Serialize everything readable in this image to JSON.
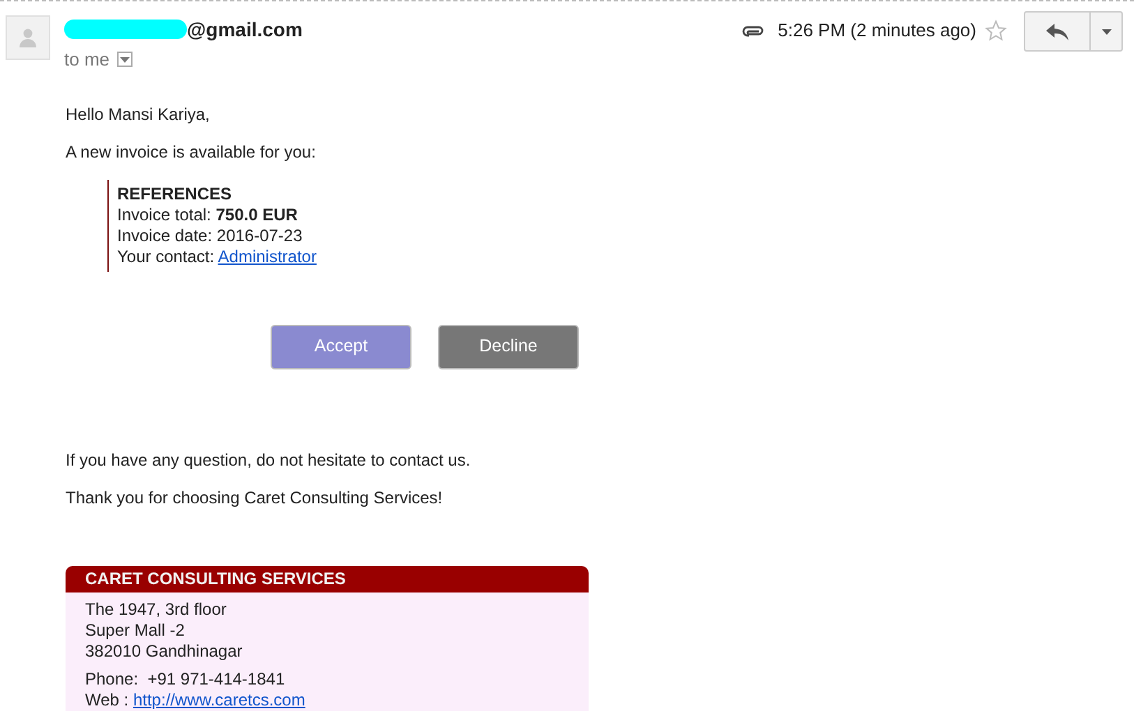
{
  "header": {
    "sender": "@gmail.com",
    "recipient": "to me",
    "time": "5:26 PM (2 minutes ago)",
    "starred": false
  },
  "body": {
    "greeting": "Hello Mansi Kariya,",
    "intro": "A new invoice is available for you:",
    "references": {
      "title": "REFERENCES",
      "lines": [
        {
          "label": "Invoice total: ",
          "value": "750.0 EUR",
          "kind": "bold"
        },
        {
          "label": "Invoice date: ",
          "value": "2016-07-23",
          "kind": "plain"
        },
        {
          "label": "Your contact: ",
          "value": "Administrator",
          "kind": "link"
        }
      ]
    },
    "buttons": [
      {
        "label": "Accept",
        "color": "#8a8ad0"
      },
      {
        "label": "Decline",
        "color": "#777777"
      }
    ],
    "closing": [
      "If you have any question, do not hesitate to contact us.",
      "Thank you for choosing Caret Consulting Services!"
    ]
  },
  "footer": {
    "company": "CARET CONSULTING SERVICES",
    "address": [
      "The 1947, 3rd floor",
      "Super Mall -2",
      "382010 Gandhinagar"
    ],
    "phone": "Phone:  +91 971-414-1841",
    "web_label": "Web : ",
    "web": "http://www.caretcs.com"
  }
}
